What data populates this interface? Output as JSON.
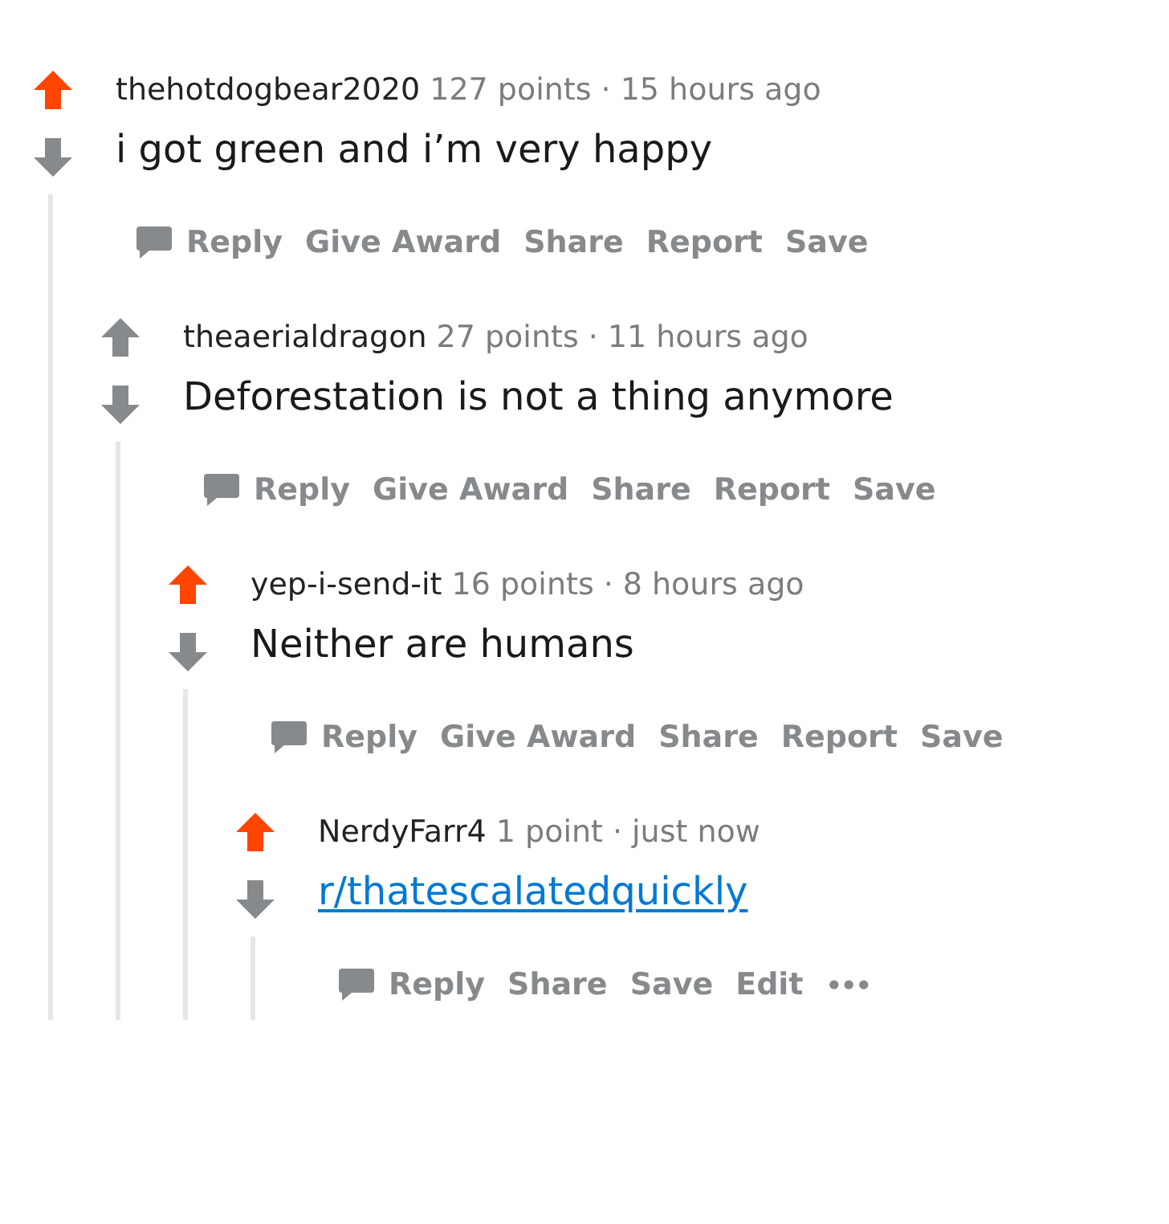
{
  "comment": {
    "author": "thehotdogbear2020",
    "points": "127 points",
    "separator": "·",
    "time": "15 hours ago",
    "upvoted": true,
    "body": "i got green and i’m very happy",
    "actions": [
      {
        "kind": "reply",
        "label": "Reply"
      },
      {
        "kind": "text",
        "label": "Give Award"
      },
      {
        "kind": "text",
        "label": "Share"
      },
      {
        "kind": "text",
        "label": "Report"
      },
      {
        "kind": "text",
        "label": "Save"
      }
    ],
    "children": [
      {
        "author": "theaerialdragon",
        "points": "27 points",
        "separator": "·",
        "time": "11 hours ago",
        "upvoted": false,
        "body": "Deforestation is not a thing anymore",
        "actions": [
          {
            "kind": "reply",
            "label": "Reply"
          },
          {
            "kind": "text",
            "label": "Give Award"
          },
          {
            "kind": "text",
            "label": "Share"
          },
          {
            "kind": "text",
            "label": "Report"
          },
          {
            "kind": "text",
            "label": "Save"
          }
        ],
        "children": [
          {
            "author": "yep-i-send-it",
            "points": "16 points",
            "separator": "·",
            "time": "8 hours ago",
            "upvoted": true,
            "body": "Neither are humans",
            "actions": [
              {
                "kind": "reply",
                "label": "Reply"
              },
              {
                "kind": "text",
                "label": "Give Award"
              },
              {
                "kind": "text",
                "label": "Share"
              },
              {
                "kind": "text",
                "label": "Report"
              },
              {
                "kind": "text",
                "label": "Save"
              }
            ],
            "children": [
              {
                "author": "NerdyFarr4",
                "points": "1 point",
                "separator": "·",
                "time": "just now",
                "upvoted": true,
                "body": "r/thatescalatedquickly",
                "body_link": true,
                "actions": [
                  {
                    "kind": "reply",
                    "label": "Reply"
                  },
                  {
                    "kind": "text",
                    "label": "Share"
                  },
                  {
                    "kind": "text",
                    "label": "Save"
                  },
                  {
                    "kind": "text",
                    "label": "Edit"
                  },
                  {
                    "kind": "more",
                    "label": "•••"
                  }
                ]
              }
            ]
          }
        ]
      }
    ]
  }
}
